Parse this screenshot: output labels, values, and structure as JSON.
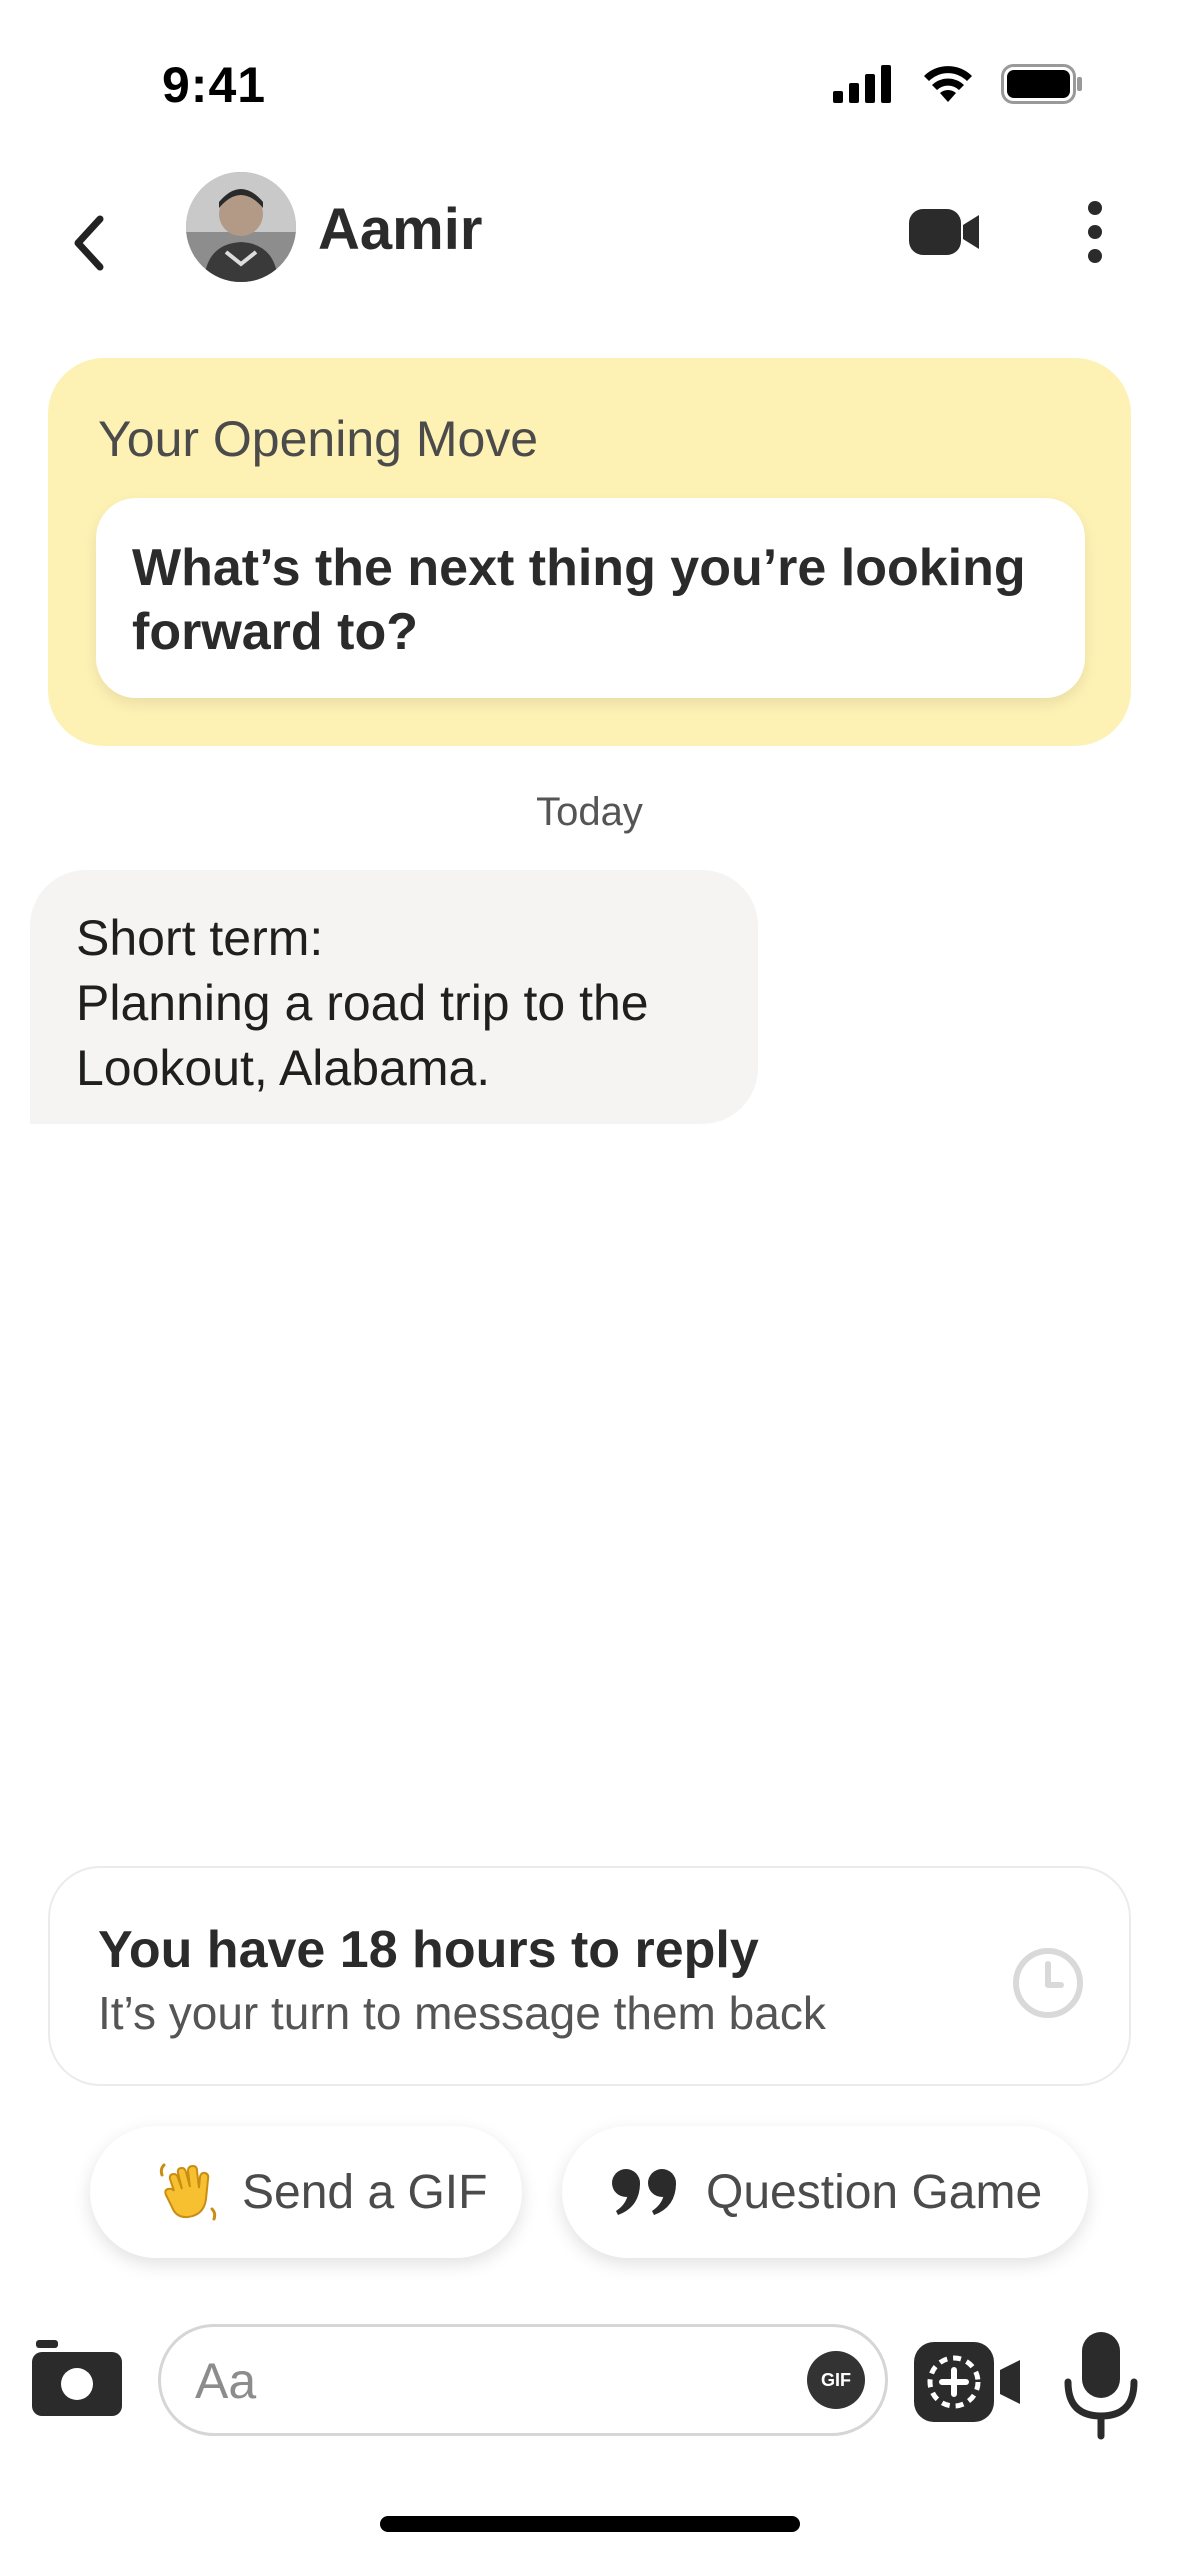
{
  "status_bar": {
    "time": "9:41"
  },
  "header": {
    "contact_name": "Aamir"
  },
  "opening_move": {
    "title": "Your Opening Move",
    "question": "What’s the next thing you’re looking forward to?"
  },
  "conversation": {
    "day_label": "Today",
    "messages": [
      {
        "lines": [
          "Short term:",
          "Planning a road trip to the",
          "Lookout, Alabama."
        ]
      }
    ]
  },
  "reply_timer": {
    "title": "You have 18 hours to reply",
    "subtitle": "It’s your turn to message them back"
  },
  "suggestions": {
    "gif_label": "Send a GIF",
    "question_label": "Question Game"
  },
  "composer": {
    "placeholder": "Aa",
    "gif_badge": "GIF"
  },
  "colors": {
    "opening_card_bg": "#fdf1b4",
    "bubble_bg": "#f5f4f2"
  }
}
